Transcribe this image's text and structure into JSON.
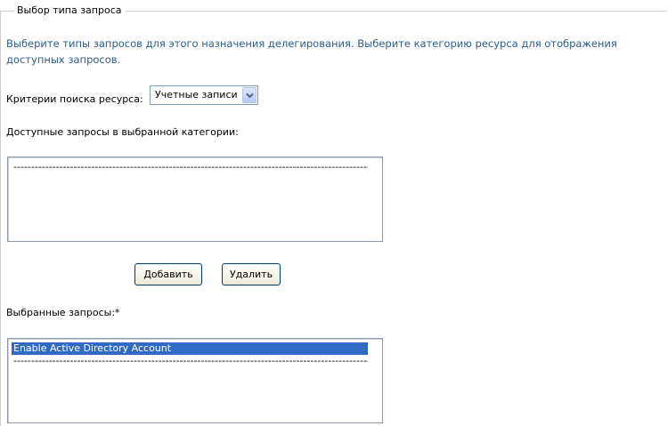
{
  "section": {
    "legend": "Выбор типа запроса",
    "intro": "Выберите типы запросов для этого назначения делегирования. Выберите категорию ресурса для отображения доступных запросов."
  },
  "criteria": {
    "label": "Критерии поиска ресурса:",
    "selected_value": "Учетные записи"
  },
  "available": {
    "label": "Доступные запросы в выбранной категории:",
    "items": [
      "------------------------------------------------------------------------------------------------------"
    ]
  },
  "buttons": {
    "add_label": "Добавить",
    "remove_label": "Удалить"
  },
  "selected": {
    "label": "Выбранные запросы:*",
    "items": [
      "Enable Active Directory Account",
      "------------------------------------------------------------------------------------------------------"
    ],
    "highlighted_index": 0
  },
  "colors": {
    "intro_text": "#2e5c8a",
    "highlight_bg": "#316ac5",
    "button_border": "#003c74"
  }
}
